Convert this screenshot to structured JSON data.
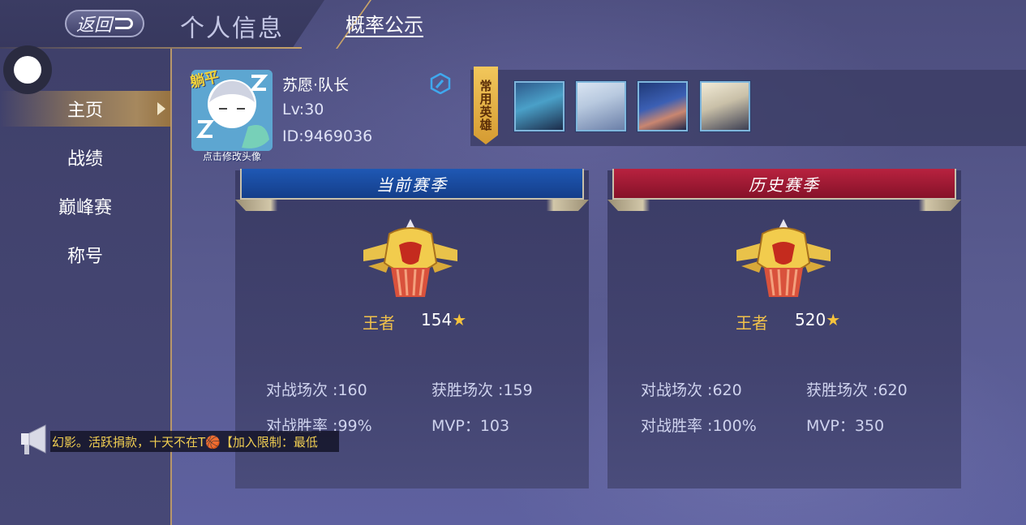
{
  "topbar": {
    "back_label": "返回",
    "tab_personal": "个人信息",
    "tab_probability": "概率公示"
  },
  "sidebar": {
    "items": [
      {
        "label": "主页",
        "active": true
      },
      {
        "label": "战绩",
        "active": false
      },
      {
        "label": "巅峰赛",
        "active": false
      },
      {
        "label": "称号",
        "active": false
      }
    ]
  },
  "profile": {
    "avatar_badge": "躺平",
    "avatar_caption": "点击修改头像",
    "name": "苏愿·队长",
    "level": "Lv:30",
    "id": "ID:9469036"
  },
  "heroes": {
    "tag": "常用英雄",
    "icons": [
      "hero-portrait-1",
      "hero-portrait-2",
      "hero-portrait-3",
      "hero-portrait-4"
    ]
  },
  "seasons": {
    "current": {
      "title": "当前赛季",
      "rank": "王者",
      "stars": "154",
      "battles_label": "对战场次 :160",
      "wins_label": "获胜场次 :159",
      "winrate_label": "对战胜率 :99%",
      "mvp_label": "MVP：103"
    },
    "history": {
      "title": "历史赛季",
      "rank": "王者",
      "stars": "520",
      "battles_label": "对战场次 :620",
      "wins_label": "获胜场次 :620",
      "winrate_label": "对战胜率 :100%",
      "mvp_label": "MVP：350"
    }
  },
  "notice": {
    "text": "幻影。活跃捐款，十天不在T🏀【加入限制：最低"
  },
  "colors": {
    "gold_accent": "#c9a468",
    "rank_gold": "#f2c24a",
    "current_banner": "#1f58b4",
    "history_banner": "#b8223f"
  }
}
